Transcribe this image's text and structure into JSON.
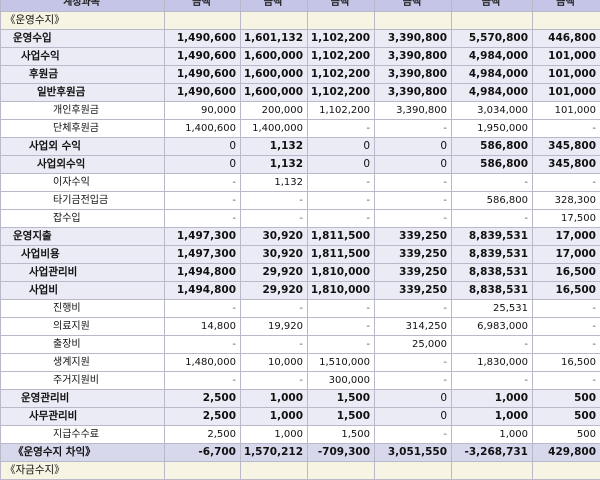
{
  "header": {
    "label": "계정과목",
    "amount_label": "금액"
  },
  "rows": [
    {
      "name": "section-operating-balance",
      "label": "《운영수지》",
      "style": "section",
      "indent": 0,
      "values": [
        "",
        "",
        "",
        "",
        "",
        ""
      ]
    },
    {
      "name": "operating-income",
      "label": "운영수입",
      "style": "bold group",
      "indent": 1,
      "values": [
        "1,490,600",
        "1,601,132",
        "1,102,200",
        "3,390,800",
        "5,570,800",
        "446,800"
      ]
    },
    {
      "name": "business-income",
      "label": "사업수익",
      "style": "bold group",
      "indent": 2,
      "values": [
        "1,490,600",
        "1,600,000",
        "1,102,200",
        "3,390,800",
        "4,984,000",
        "101,000"
      ]
    },
    {
      "name": "donations",
      "label": "후원금",
      "style": "bold group",
      "indent": 3,
      "values": [
        "1,490,600",
        "1,600,000",
        "1,102,200",
        "3,390,800",
        "4,984,000",
        "101,000"
      ]
    },
    {
      "name": "general-donations",
      "label": "일반후원금",
      "style": "bold group",
      "indent": 4,
      "values": [
        "1,490,600",
        "1,600,000",
        "1,102,200",
        "3,390,800",
        "4,984,000",
        "101,000"
      ]
    },
    {
      "name": "individual-donations",
      "label": "개인후원금",
      "style": "detail",
      "indent": 6,
      "values": [
        "90,000",
        "200,000",
        "1,102,200",
        "3,390,800",
        "3,034,000",
        "101,000"
      ]
    },
    {
      "name": "group-donations",
      "label": "단체후원금",
      "style": "detail",
      "indent": 6,
      "values": [
        "1,400,600",
        "1,400,000",
        "-",
        "-",
        "1,950,000",
        "-"
      ]
    },
    {
      "name": "non-business-income",
      "label": "사업외 수익",
      "style": "bold group",
      "indent": 3,
      "values": [
        "0",
        "1,132",
        "0",
        "0",
        "586,800",
        "345,800"
      ]
    },
    {
      "name": "non-business-income-sub",
      "label": "사업외수익",
      "style": "bold group",
      "indent": 4,
      "values": [
        "0",
        "1,132",
        "0",
        "0",
        "586,800",
        "345,800"
      ]
    },
    {
      "name": "interest-income",
      "label": "이자수익",
      "style": "detail",
      "indent": 6,
      "values": [
        "-",
        "1,132",
        "-",
        "-",
        "-",
        "-"
      ]
    },
    {
      "name": "other-fund-transfer",
      "label": "타기금전입금",
      "style": "detail",
      "indent": 6,
      "values": [
        "-",
        "-",
        "-",
        "-",
        "586,800",
        "328,300"
      ]
    },
    {
      "name": "misc-income",
      "label": "잡수입",
      "style": "detail",
      "indent": 6,
      "values": [
        "-",
        "-",
        "-",
        "-",
        "-",
        "17,500"
      ]
    },
    {
      "name": "operating-expense",
      "label": "운영지출",
      "style": "bold group",
      "indent": 1,
      "values": [
        "1,497,300",
        "30,920",
        "1,811,500",
        "339,250",
        "8,839,531",
        "17,000"
      ]
    },
    {
      "name": "business-expense",
      "label": "사업비용",
      "style": "bold group",
      "indent": 2,
      "values": [
        "1,497,300",
        "30,920",
        "1,811,500",
        "339,250",
        "8,839,531",
        "17,000"
      ]
    },
    {
      "name": "business-admin-cost",
      "label": "사업관리비",
      "style": "bold group",
      "indent": 3,
      "values": [
        "1,494,800",
        "29,920",
        "1,810,000",
        "339,250",
        "8,838,531",
        "16,500"
      ]
    },
    {
      "name": "program-cost",
      "label": "사업비",
      "style": "bold group",
      "indent": 3,
      "values": [
        "1,494,800",
        "29,920",
        "1,810,000",
        "339,250",
        "8,838,531",
        "16,500"
      ]
    },
    {
      "name": "progress-cost",
      "label": "진행비",
      "style": "detail",
      "indent": 6,
      "values": [
        "-",
        "-",
        "-",
        "-",
        "25,531",
        "-"
      ]
    },
    {
      "name": "medical-support",
      "label": "의료지원",
      "style": "detail",
      "indent": 6,
      "values": [
        "14,800",
        "19,920",
        "-",
        "314,250",
        "6,983,000",
        "-"
      ]
    },
    {
      "name": "trip-cost",
      "label": "출장비",
      "style": "detail",
      "indent": 6,
      "values": [
        "-",
        "-",
        "-",
        "25,000",
        "-",
        "-"
      ]
    },
    {
      "name": "living-support",
      "label": "생계지원",
      "style": "detail",
      "indent": 6,
      "values": [
        "1,480,000",
        "10,000",
        "1,510,000",
        "-",
        "1,830,000",
        "16,500"
      ]
    },
    {
      "name": "housing-support",
      "label": "주거지원비",
      "style": "detail",
      "indent": 6,
      "values": [
        "-",
        "-",
        "300,000",
        "-",
        "-",
        "-"
      ]
    },
    {
      "name": "operating-admin-cost",
      "label": "운영관리비",
      "style": "bold group",
      "indent": 2,
      "values": [
        "2,500",
        "1,000",
        "1,500",
        "0",
        "1,000",
        "500"
      ]
    },
    {
      "name": "office-admin-cost",
      "label": "사무관리비",
      "style": "bold group",
      "indent": 3,
      "values": [
        "2,500",
        "1,000",
        "1,500",
        "0",
        "1,000",
        "500"
      ]
    },
    {
      "name": "payment-fees",
      "label": "지급수수료",
      "style": "detail",
      "indent": 6,
      "values": [
        "2,500",
        "1,000",
        "1,500",
        "-",
        "1,000",
        "500"
      ]
    },
    {
      "name": "operating-balance-diff",
      "label": "《운영수지 차익》",
      "style": "total",
      "indent": 1,
      "values": [
        "-6,700",
        "1,570,212",
        "-709,300",
        "3,051,550",
        "-3,268,731",
        "429,800"
      ]
    },
    {
      "name": "section-fund-balance",
      "label": "《자금수지》",
      "style": "section",
      "indent": 0,
      "values": [
        "",
        "",
        "",
        "",
        "",
        ""
      ]
    }
  ]
}
